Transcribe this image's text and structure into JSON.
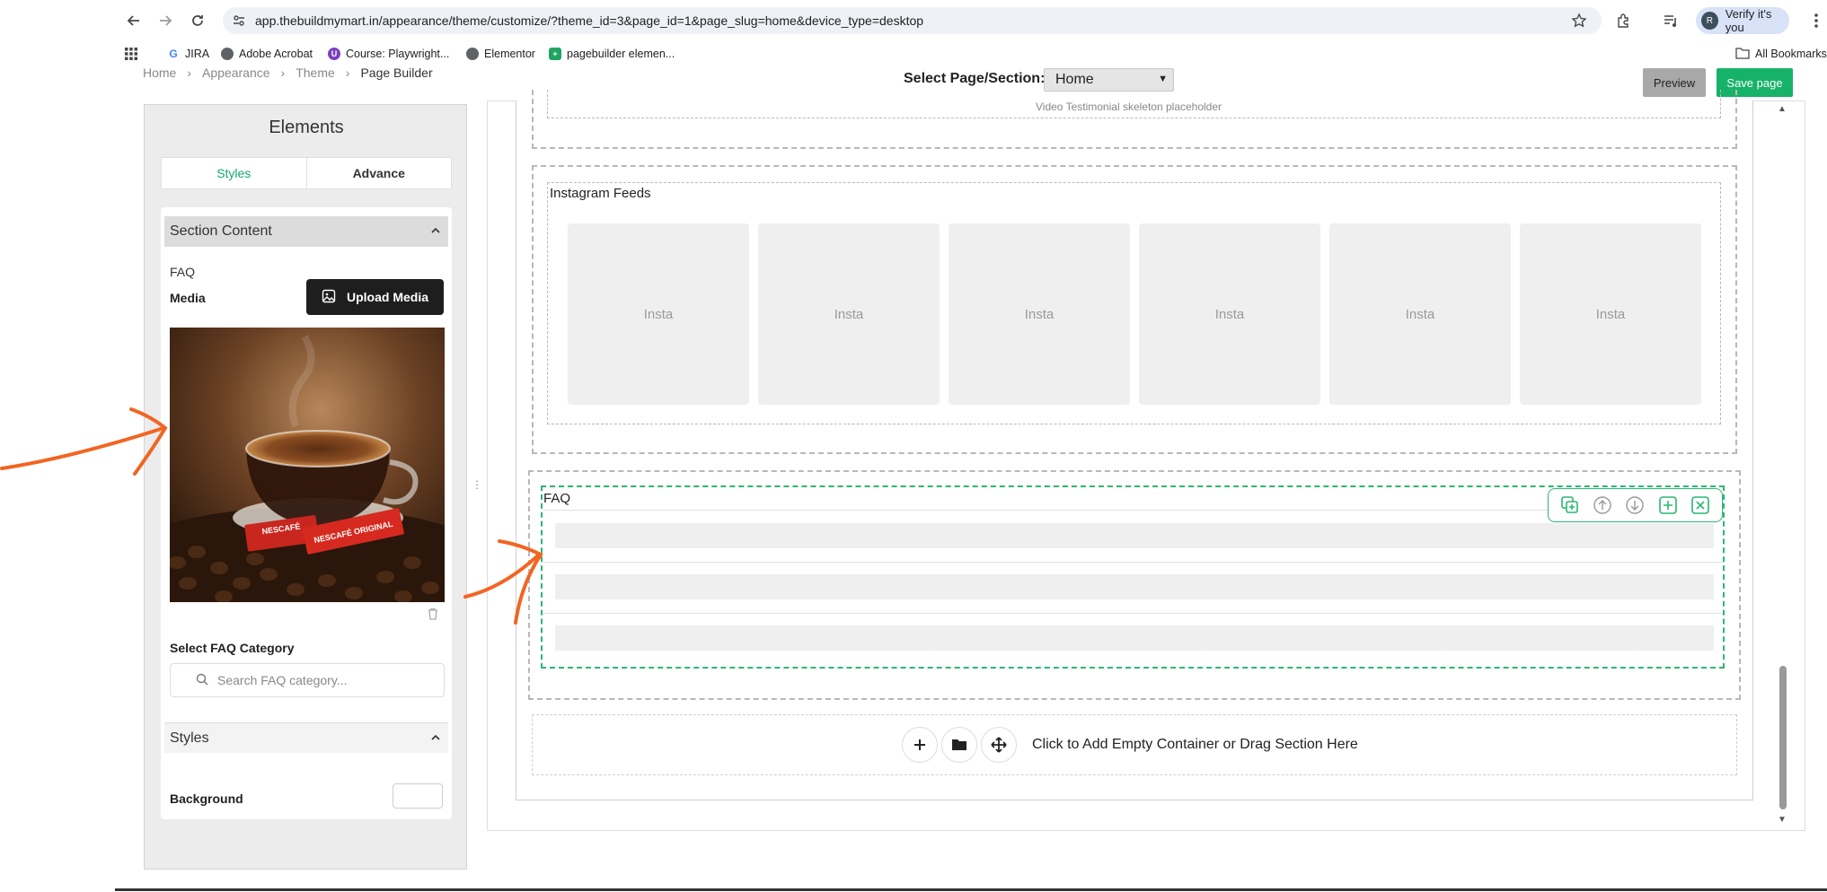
{
  "browser": {
    "url": "app.thebuildmymart.in/appearance/theme/customize/?theme_id=3&page_id=1&page_slug=home&device_type=desktop",
    "profile_label": "Verify it's you",
    "profile_initial": "R",
    "bookmarks": [
      "JIRA",
      "Adobe Acrobat",
      "Course: Playwright...",
      "Elementor",
      "pagebuilder elemen..."
    ],
    "all_bookmarks": "All Bookmarks"
  },
  "header": {
    "breadcrumb": [
      "Home",
      "Appearance",
      "Theme",
      "Page Builder"
    ],
    "select_label": "Select Page/Section:",
    "select_value": "Home",
    "preview_label": "Preview",
    "save_label": "Save page"
  },
  "panel": {
    "title": "Elements",
    "tabs": [
      "Styles",
      "Advance"
    ],
    "section_content_label": "Section Content",
    "faq_label": "FAQ",
    "media_label": "Media",
    "upload_label": "Upload Media",
    "faq_category_label": "Select FAQ Category",
    "search_placeholder": "Search FAQ category...",
    "styles_label": "Styles",
    "background_label": "Background",
    "product_text_1": "NESCAFÉ",
    "product_text_2": "NESCAFÉ ORIGINAL"
  },
  "canvas": {
    "video_placeholder": "Video Testimonial skeleton placeholder",
    "insta_title": "Instagram Feeds",
    "insta_tiles": [
      "Insta",
      "Insta",
      "Insta",
      "Insta",
      "Insta",
      "Insta"
    ],
    "faq_title": "FAQ",
    "add_text": "Click to Add Empty Container or Drag Section Here"
  }
}
